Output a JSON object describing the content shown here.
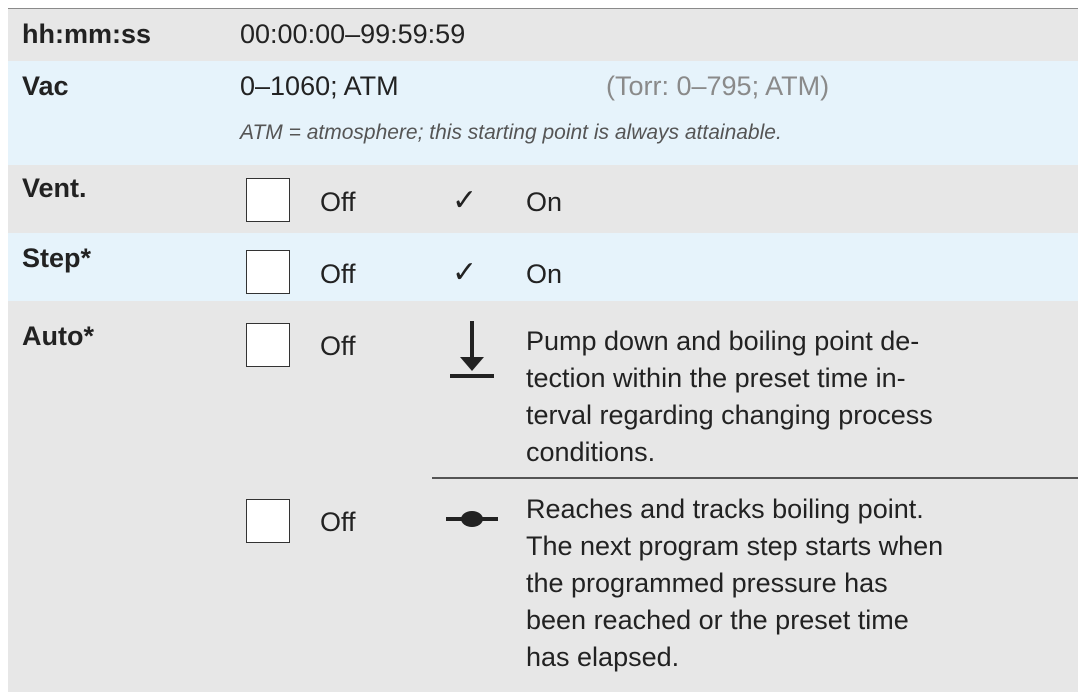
{
  "time": {
    "label": "hh:mm:ss",
    "range": "00:00:00–99:59:59"
  },
  "vac": {
    "label": "Vac",
    "range": "0–1060; ATM",
    "torr": "(Torr: 0–795; ATM)",
    "note": "ATM = atmosphere; this starting point is always attainable."
  },
  "vent": {
    "label": "Vent.",
    "off": "Off",
    "check": "✓",
    "on": "On"
  },
  "step": {
    "label": "Step*",
    "off": "Off",
    "check": "✓",
    "on": "On"
  },
  "auto": {
    "label": "Auto*",
    "option1": {
      "off": "Off",
      "icon": "pump-down-icon",
      "lines": [
        "Pump down and boiling point de-",
        "tection within the preset time in-",
        "terval regarding changing process",
        "conditions."
      ]
    },
    "option2": {
      "off": "Off",
      "icon": "boiling-point-icon",
      "lines": [
        "Reaches and tracks boiling point.",
        "The next program step starts when",
        "the programmed pressure has",
        "been reached or the preset time",
        "has elapsed."
      ]
    }
  }
}
